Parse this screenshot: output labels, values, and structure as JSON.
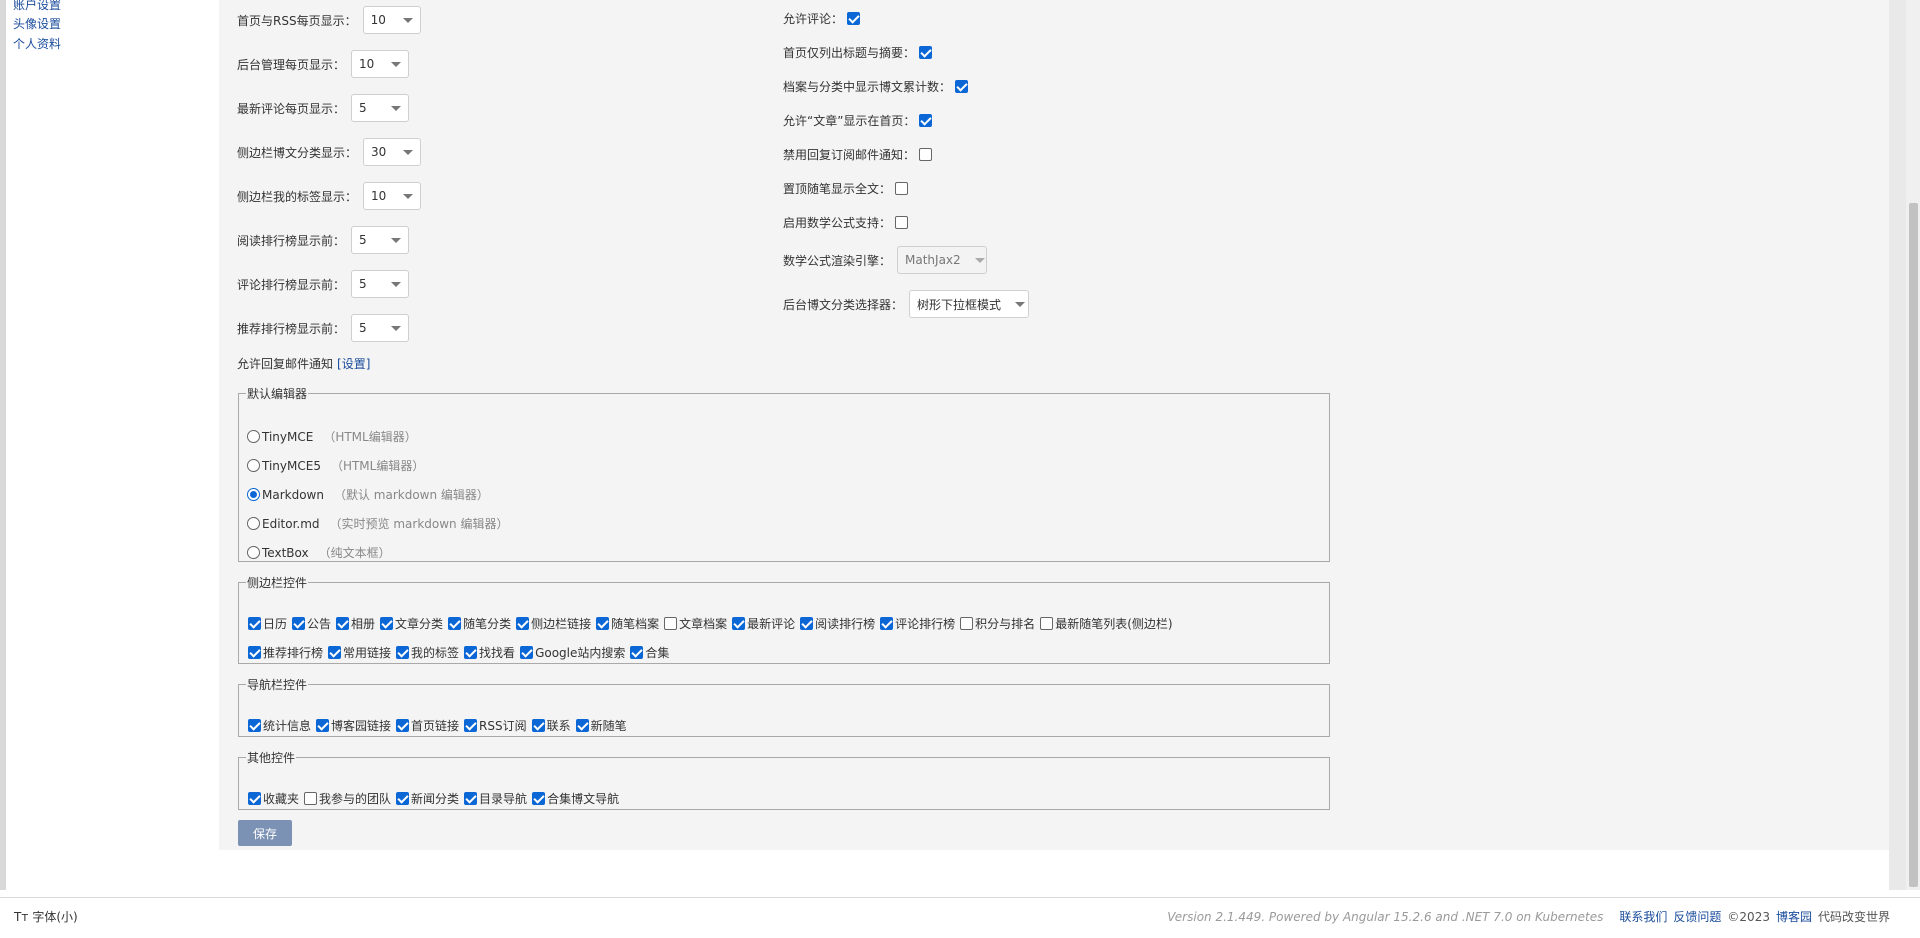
{
  "sidebar": {
    "links": [
      "账户设置",
      "头像设置",
      "个人资料"
    ]
  },
  "left_settings": [
    {
      "label": "首页与RSS每页显示：",
      "value": "10"
    },
    {
      "label": "后台管理每页显示：",
      "value": "10"
    },
    {
      "label": "最新评论每页显示：",
      "value": "5"
    },
    {
      "label": "侧边栏博文分类显示：",
      "value": "30"
    },
    {
      "label": "侧边栏我的标签显示：",
      "value": "10"
    },
    {
      "label": "阅读排行榜显示前：",
      "value": "5"
    },
    {
      "label": "评论排行榜显示前：",
      "value": "5"
    },
    {
      "label": "推荐排行榜显示前：",
      "value": "5"
    }
  ],
  "reply_mail": {
    "label": "允许回复邮件通知",
    "link": "[设置]"
  },
  "right_settings": {
    "checkboxes": [
      {
        "label": "允许评论：",
        "checked": true
      },
      {
        "label": "首页仅列出标题与摘要：",
        "checked": true
      },
      {
        "label": "档案与分类中显示博文累计数：",
        "checked": true
      },
      {
        "label": "允许“文章”显示在首页：",
        "checked": true
      },
      {
        "label": "禁用回复订阅邮件通知：",
        "checked": false
      },
      {
        "label": "置顶随笔显示全文：",
        "checked": false
      },
      {
        "label": "启用数学公式支持：",
        "checked": false
      }
    ],
    "math_engine": {
      "label": "数学公式渲染引擎：",
      "value": "MathJax2"
    },
    "category_selector": {
      "label": "后台博文分类选择器：",
      "value": "树形下拉框模式"
    }
  },
  "editor": {
    "legend": "默认编辑器",
    "options": [
      {
        "name": "TinyMCE",
        "hint": "（HTML编辑器）",
        "selected": false
      },
      {
        "name": "TinyMCE5",
        "hint": "（HTML编辑器）",
        "selected": false
      },
      {
        "name": "Markdown",
        "hint": "（默认 markdown 编辑器）",
        "selected": true
      },
      {
        "name": "Editor.md",
        "hint": "（实时预览 markdown 编辑器）",
        "selected": false
      },
      {
        "name": "TextBox",
        "hint": "（纯文本框）",
        "selected": false
      }
    ]
  },
  "sidebar_widgets": {
    "legend": "侧边栏控件",
    "row1": [
      {
        "label": "日历",
        "checked": true
      },
      {
        "label": "公告",
        "checked": true
      },
      {
        "label": "相册",
        "checked": true
      },
      {
        "label": "文章分类",
        "checked": true
      },
      {
        "label": "随笔分类",
        "checked": true
      },
      {
        "label": "侧边栏链接",
        "checked": true
      },
      {
        "label": "随笔档案",
        "checked": true
      },
      {
        "label": "文章档案",
        "checked": false
      },
      {
        "label": "最新评论",
        "checked": true
      },
      {
        "label": "阅读排行榜",
        "checked": true
      },
      {
        "label": "评论排行榜",
        "checked": true
      },
      {
        "label": "积分与排名",
        "checked": false
      },
      {
        "label": "最新随笔列表(侧边栏)",
        "checked": false
      }
    ],
    "row2": [
      {
        "label": "推荐排行榜",
        "checked": true
      },
      {
        "label": "常用链接",
        "checked": true
      },
      {
        "label": "我的标签",
        "checked": true
      },
      {
        "label": "找找看",
        "checked": true
      },
      {
        "label": "Google站内搜索",
        "checked": true
      },
      {
        "label": "合集",
        "checked": true
      }
    ]
  },
  "nav_widgets": {
    "legend": "导航栏控件",
    "items": [
      {
        "label": "统计信息",
        "checked": true
      },
      {
        "label": "博客园链接",
        "checked": true
      },
      {
        "label": "首页链接",
        "checked": true
      },
      {
        "label": "RSS订阅",
        "checked": true
      },
      {
        "label": "联系",
        "checked": true
      },
      {
        "label": "新随笔",
        "checked": true
      }
    ]
  },
  "other_widgets": {
    "legend": "其他控件",
    "items": [
      {
        "label": "收藏夹",
        "checked": true
      },
      {
        "label": "我参与的团队",
        "checked": false
      },
      {
        "label": "新闻分类",
        "checked": true
      },
      {
        "label": "目录导航",
        "checked": true
      },
      {
        "label": "合集博文导航",
        "checked": true
      }
    ]
  },
  "save_label": "保存",
  "footer": {
    "font_size_icon": "Tт",
    "font_size_label": "字体(小)",
    "version": "Version 2.1.449. Powered by Angular 15.2.6 and .NET 7.0 on Kubernetes",
    "contact": "联系我们",
    "feedback": "反馈问题",
    "copyright": "©2023",
    "brand": "博客园",
    "slogan": "代码改变世界"
  },
  "colors": {
    "checkbox": "#0b67d6",
    "link": "#1a4c9c",
    "save_button": "#7b92b4",
    "panel_bg": "#f4f4f4"
  }
}
